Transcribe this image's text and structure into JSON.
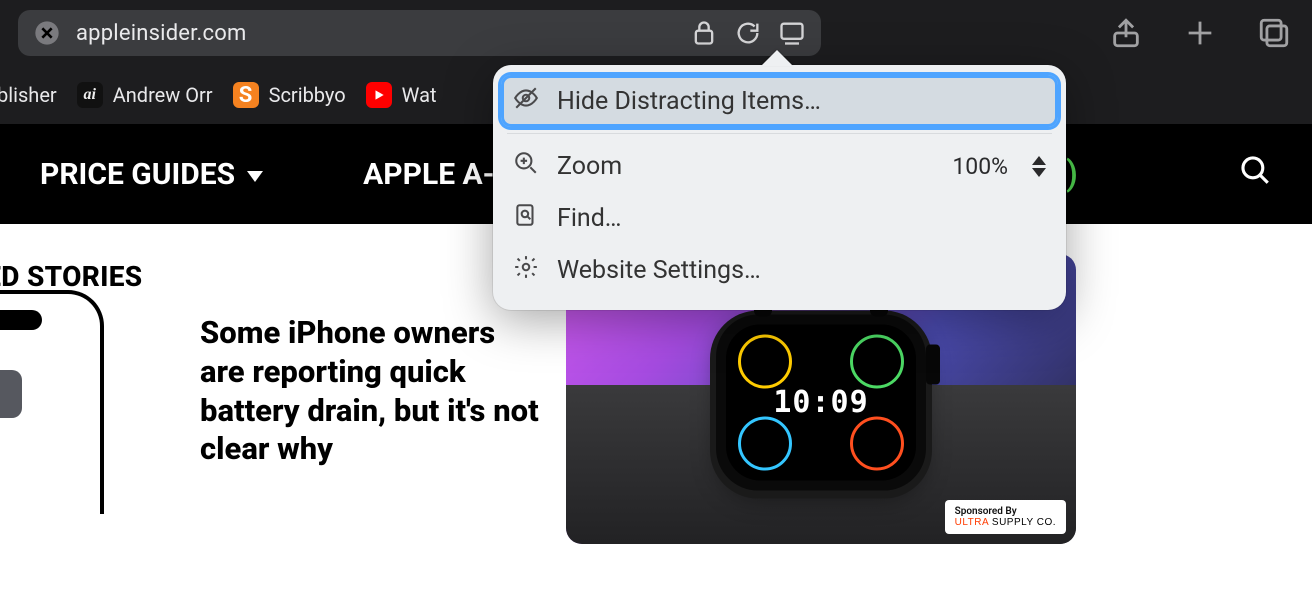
{
  "addressbar": {
    "url": "appleinsider.com"
  },
  "bookmarks": {
    "items": [
      {
        "label": "ublisher"
      },
      {
        "label": "Andrew Orr"
      },
      {
        "label": "Scribbyo"
      },
      {
        "label": "Wat"
      }
    ]
  },
  "sitenav": {
    "items": [
      {
        "label": "PRICE GUIDES",
        "has_dropdown": true
      },
      {
        "label": "APPLE A-Z"
      }
    ],
    "trailing_paren": ")"
  },
  "popover": {
    "items": [
      {
        "label": "Hide Distracting Items…",
        "highlighted": true
      },
      {
        "label": "Zoom",
        "value": "100%"
      },
      {
        "label": "Find…"
      },
      {
        "label": "Website Settings…"
      }
    ]
  },
  "page": {
    "section_label": "URED STORIES",
    "story_headline": "Some iPhone owners are reporting quick battery drain, but it's not clear why",
    "watch_time": "10:09",
    "sponsor_top": "Sponsored By",
    "sponsor_brand_a": "ULTRA",
    "sponsor_brand_b": " SUPPLY CO."
  }
}
